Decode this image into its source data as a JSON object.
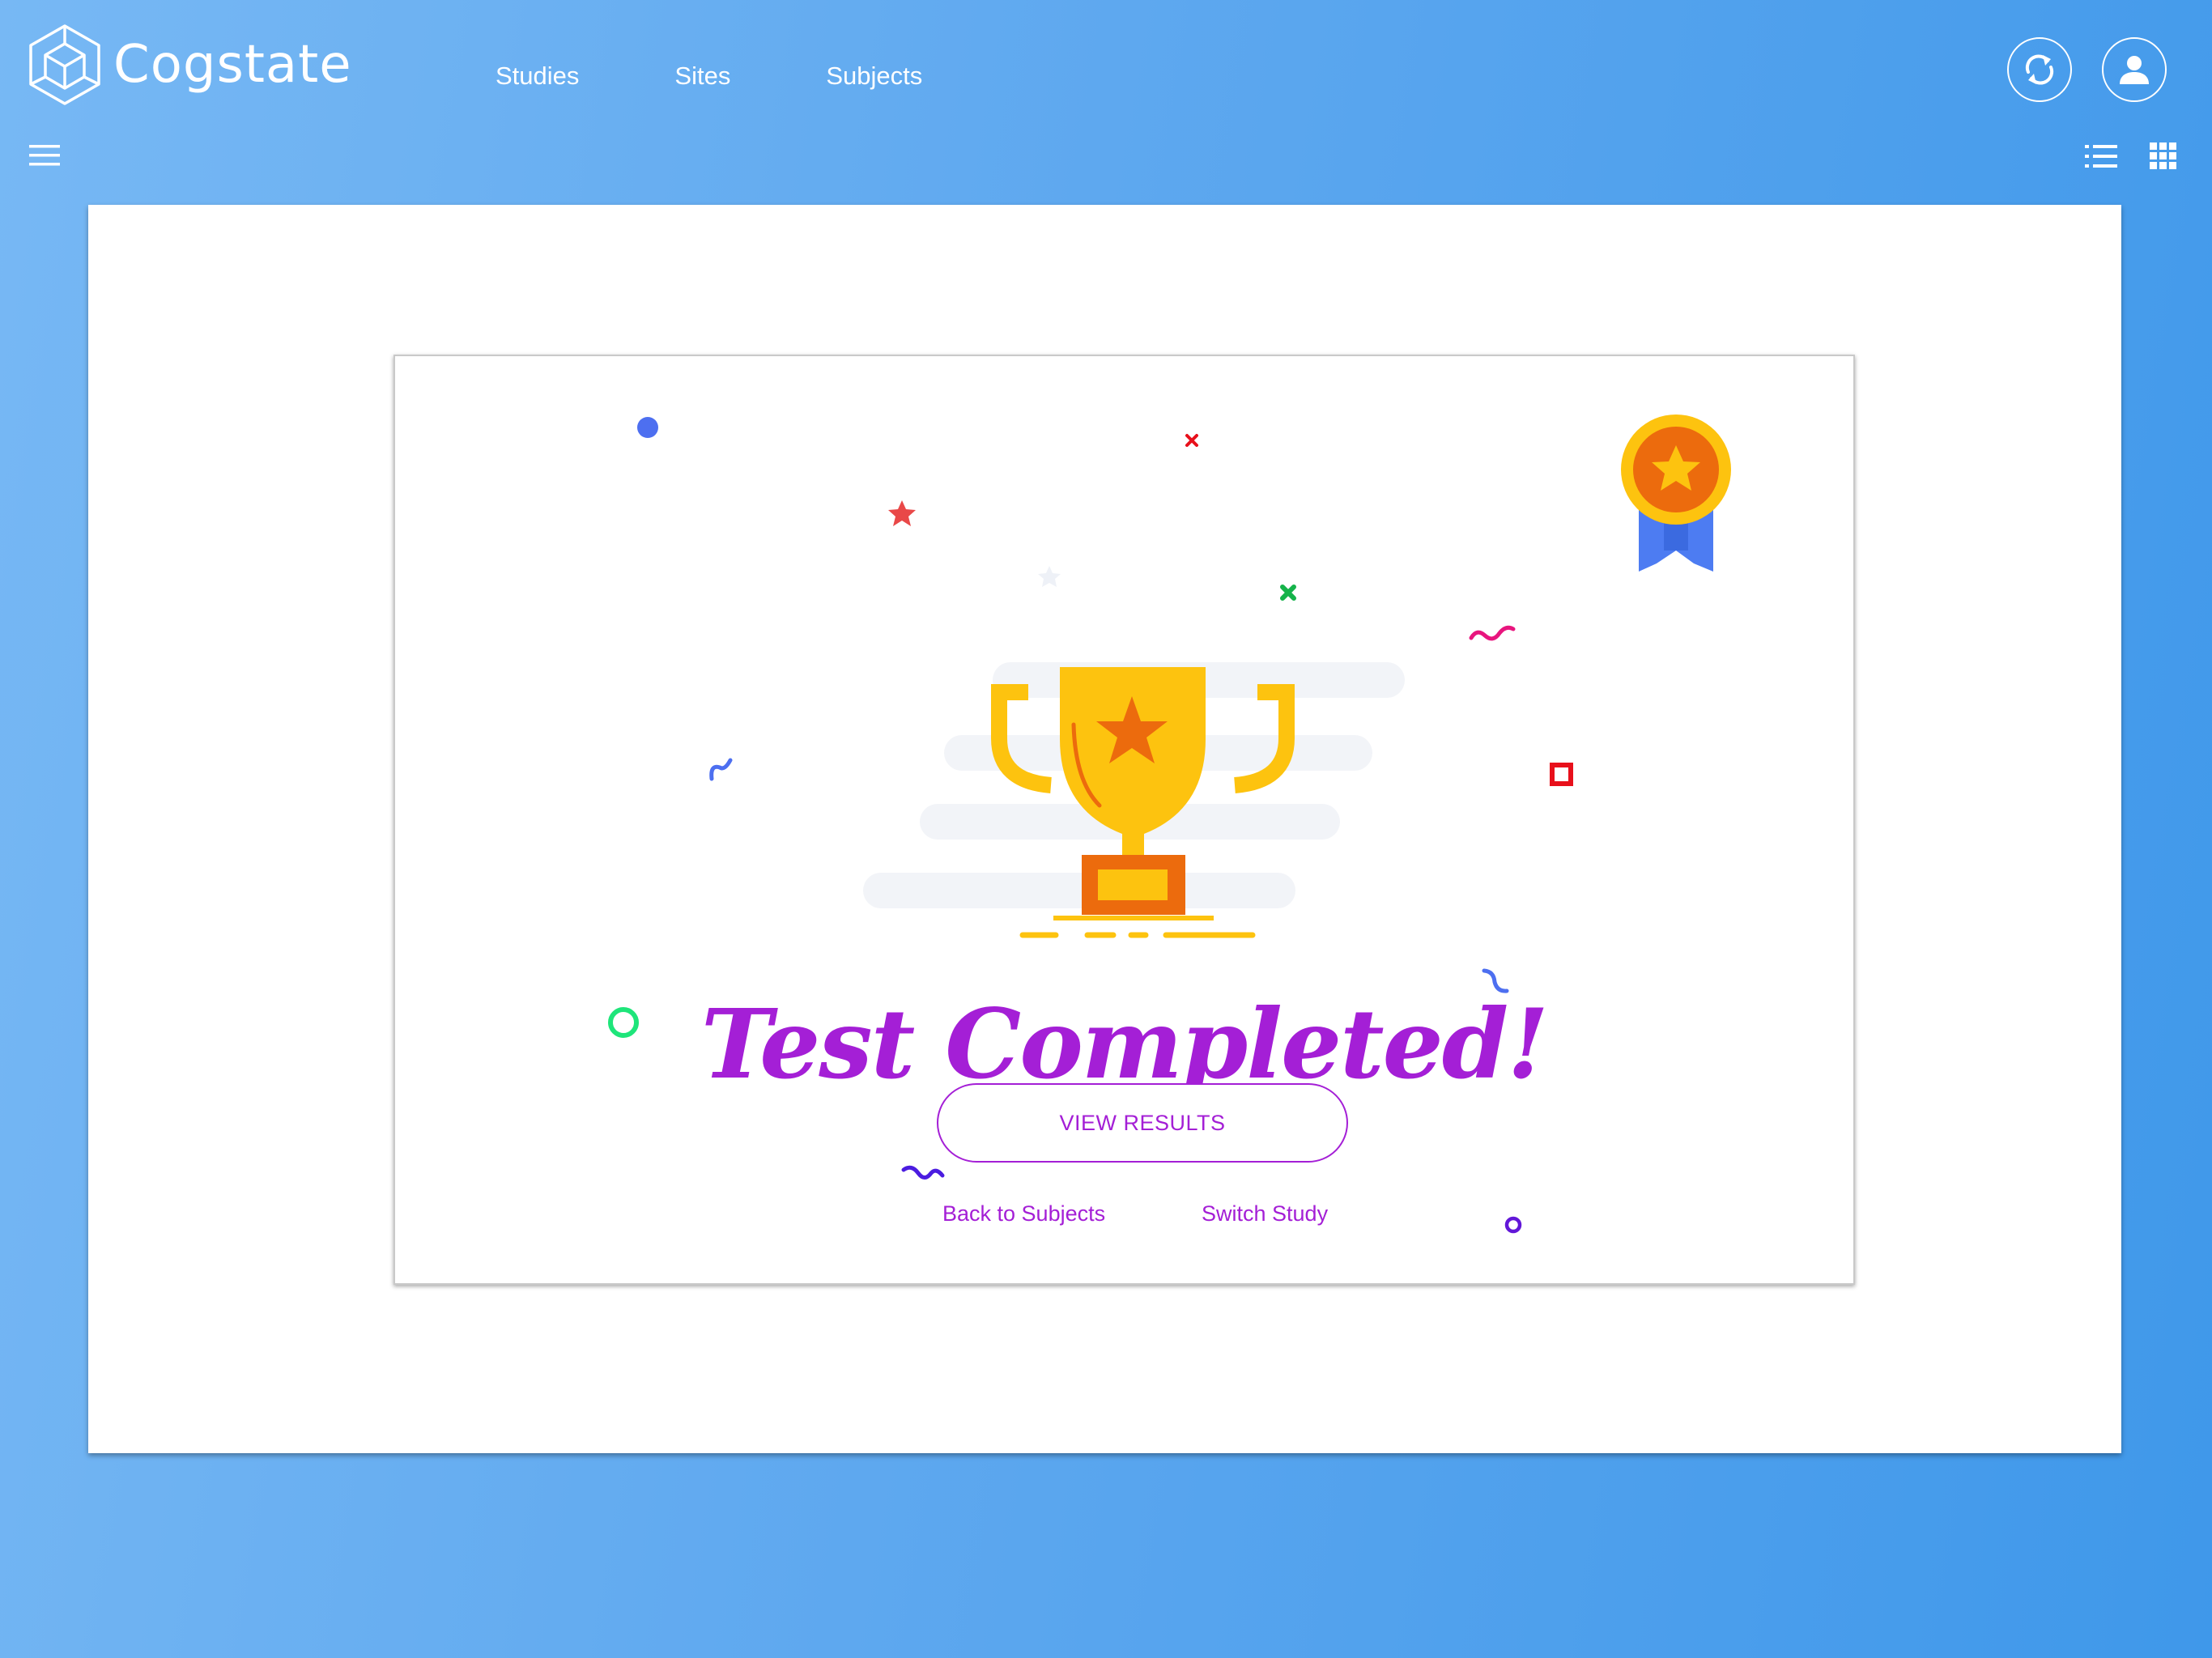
{
  "app": {
    "brand": "Cogstate",
    "logo_icon": "cube-logo-icon"
  },
  "header": {
    "nav": [
      "Studies",
      "Sites",
      "Subjects"
    ],
    "sync_icon": "sync-icon",
    "profile_icon": "person-icon"
  },
  "toolbar": {
    "menu_icon": "hamburger-menu-icon",
    "list_icon": "list-view-icon",
    "grid_icon": "grid-view-icon"
  },
  "completion": {
    "title": "Test Completed!",
    "primary_action": "VIEW RESULTS",
    "links": {
      "back": "Back to Subjects",
      "switch": "Switch Study"
    },
    "illustration": {
      "trophy_icon": "trophy-icon",
      "medal_icon": "medal-ribbon-icon"
    }
  },
  "colors": {
    "accent": "#a41fd6",
    "background_start": "#77b8f4",
    "background_end": "#3f98ea",
    "trophy": "#fdc30f",
    "trophy_dark": "#ec6b0d",
    "ribbon": "#4d7cf2"
  }
}
